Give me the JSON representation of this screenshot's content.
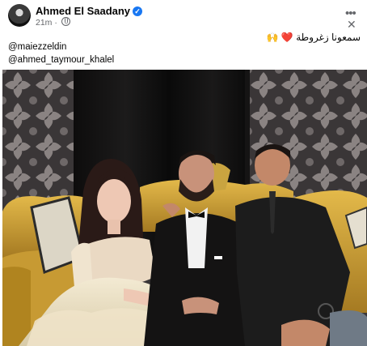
{
  "post": {
    "author": "Ahmed El Saadany",
    "time": "21m",
    "privacy_icon": "globe-icon",
    "caption": "سمعونا زغروطة",
    "caption_emojis": "❤️ 🙌",
    "mentions": [
      "@maiezzeldin",
      "@ahmed_taymour_khalel"
    ]
  },
  "photo": {
    "description_icons": []
  },
  "colors": {
    "verified": "#1877f2",
    "muted": "#65676b"
  }
}
